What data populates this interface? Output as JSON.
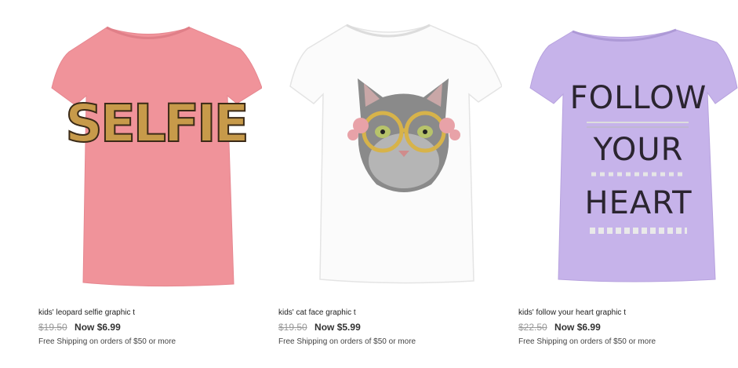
{
  "products": [
    {
      "name": "kids' leopard selfie graphic t",
      "original_price": "$19.50",
      "sale_price": "Now $6.99",
      "shipping": "Free Shipping on orders of $50 or more",
      "graphic_text": "SELFIE",
      "shirt_color": "#f0939a",
      "graphic_color": "#c79a4a"
    },
    {
      "name": "kids' cat face graphic t",
      "original_price": "$19.50",
      "sale_price": "Now $5.99",
      "shipping": "Free Shipping on orders of $50 or more",
      "shirt_color": "#fbfbfb",
      "graphic_color": "#8a8a8a"
    },
    {
      "name": "kids' follow your heart graphic t",
      "original_price": "$22.50",
      "sale_price": "Now $6.99",
      "shipping": "Free Shipping on orders of $50 or more",
      "graphic_lines": [
        "FOLLOW",
        "YOUR",
        "HEART"
      ],
      "shirt_color": "#c6b3ea",
      "graphic_color": "#2b2530"
    }
  ]
}
